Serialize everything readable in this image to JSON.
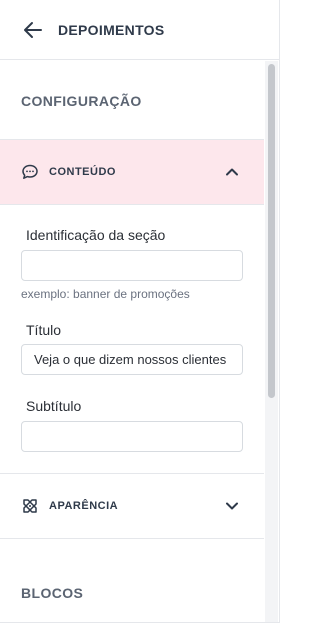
{
  "header": {
    "title": "DEPOIMENTOS"
  },
  "config_heading": "CONFIGURAÇÃO",
  "conteudo": {
    "label": "CONTEÚDO",
    "fields": {
      "identificacao": {
        "label": "Identificação da seção",
        "value": "",
        "hint": "exemplo: banner de promoções"
      },
      "titulo": {
        "label": "Título",
        "value": "Veja o que dizem nossos clientes"
      },
      "subtitulo": {
        "label": "Subtítulo",
        "value": ""
      }
    }
  },
  "aparencia": {
    "label": "APARÊNCIA"
  },
  "blocos_heading": "BLOCOS",
  "colors": {
    "active_section_bg": "#fde7ec",
    "border": "#e5e7eb"
  }
}
